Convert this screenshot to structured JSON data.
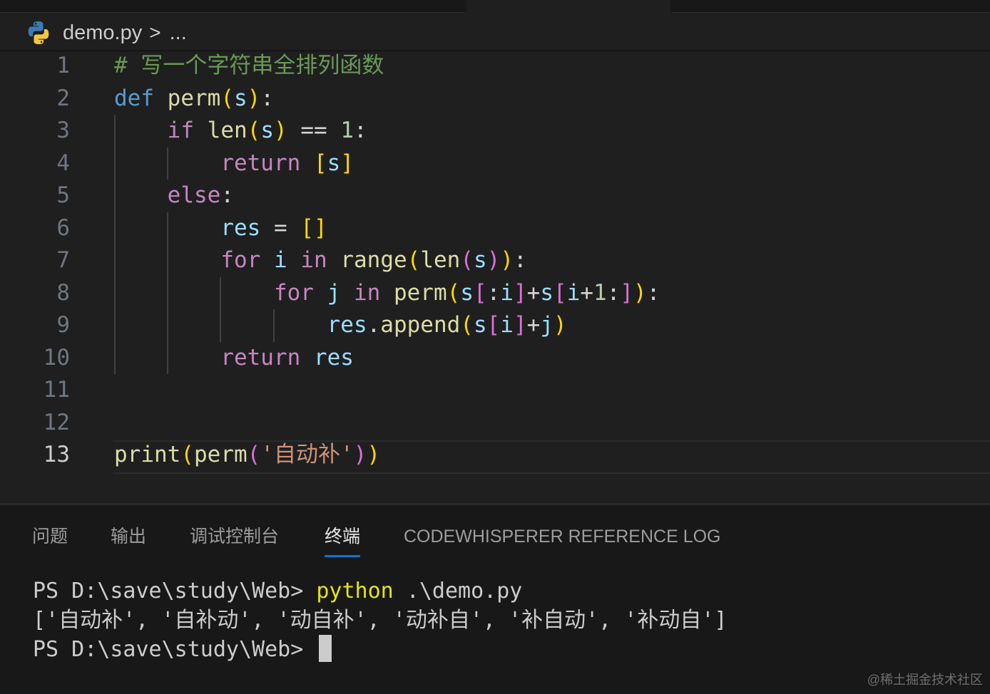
{
  "breadcrumb": {
    "file": "demo.py",
    "separator": ">",
    "ellipsis": "..."
  },
  "editor": {
    "lines": [
      {
        "num": "1",
        "t": [
          {
            "c": "cm",
            "v": "# 写一个字符串全排列函数"
          }
        ]
      },
      {
        "num": "2",
        "t": [
          {
            "c": "df",
            "v": "def"
          },
          {
            "c": "op",
            "v": " "
          },
          {
            "c": "fn",
            "v": "perm"
          },
          {
            "c": "b1",
            "v": "("
          },
          {
            "c": "vr",
            "v": "s"
          },
          {
            "c": "b1",
            "v": ")"
          },
          {
            "c": "op",
            "v": ":"
          }
        ]
      },
      {
        "num": "3",
        "t": [
          {
            "c": "op",
            "v": "    "
          },
          {
            "c": "kw",
            "v": "if"
          },
          {
            "c": "op",
            "v": " "
          },
          {
            "c": "fn",
            "v": "len"
          },
          {
            "c": "b1",
            "v": "("
          },
          {
            "c": "vr",
            "v": "s"
          },
          {
            "c": "b1",
            "v": ")"
          },
          {
            "c": "op",
            "v": " == "
          },
          {
            "c": "nm",
            "v": "1"
          },
          {
            "c": "op",
            "v": ":"
          }
        ]
      },
      {
        "num": "4",
        "t": [
          {
            "c": "op",
            "v": "        "
          },
          {
            "c": "kw",
            "v": "return"
          },
          {
            "c": "op",
            "v": " "
          },
          {
            "c": "b1",
            "v": "["
          },
          {
            "c": "vr",
            "v": "s"
          },
          {
            "c": "b1",
            "v": "]"
          }
        ]
      },
      {
        "num": "5",
        "t": [
          {
            "c": "op",
            "v": "    "
          },
          {
            "c": "kw",
            "v": "else"
          },
          {
            "c": "op",
            "v": ":"
          }
        ]
      },
      {
        "num": "6",
        "t": [
          {
            "c": "op",
            "v": "        "
          },
          {
            "c": "vr",
            "v": "res"
          },
          {
            "c": "op",
            "v": " = "
          },
          {
            "c": "b1",
            "v": "[]"
          }
        ]
      },
      {
        "num": "7",
        "t": [
          {
            "c": "op",
            "v": "        "
          },
          {
            "c": "kw",
            "v": "for"
          },
          {
            "c": "op",
            "v": " "
          },
          {
            "c": "vr",
            "v": "i"
          },
          {
            "c": "op",
            "v": " "
          },
          {
            "c": "kw",
            "v": "in"
          },
          {
            "c": "op",
            "v": " "
          },
          {
            "c": "fn",
            "v": "range"
          },
          {
            "c": "b1",
            "v": "("
          },
          {
            "c": "fn",
            "v": "len"
          },
          {
            "c": "b2",
            "v": "("
          },
          {
            "c": "vr",
            "v": "s"
          },
          {
            "c": "b2",
            "v": ")"
          },
          {
            "c": "b1",
            "v": ")"
          },
          {
            "c": "op",
            "v": ":"
          }
        ]
      },
      {
        "num": "8",
        "t": [
          {
            "c": "op",
            "v": "            "
          },
          {
            "c": "kw",
            "v": "for"
          },
          {
            "c": "op",
            "v": " "
          },
          {
            "c": "vr",
            "v": "j"
          },
          {
            "c": "op",
            "v": " "
          },
          {
            "c": "kw",
            "v": "in"
          },
          {
            "c": "op",
            "v": " "
          },
          {
            "c": "fn",
            "v": "perm"
          },
          {
            "c": "b1",
            "v": "("
          },
          {
            "c": "vr",
            "v": "s"
          },
          {
            "c": "b2",
            "v": "["
          },
          {
            "c": "op",
            "v": ":"
          },
          {
            "c": "vr",
            "v": "i"
          },
          {
            "c": "b2",
            "v": "]"
          },
          {
            "c": "op",
            "v": "+"
          },
          {
            "c": "vr",
            "v": "s"
          },
          {
            "c": "b2",
            "v": "["
          },
          {
            "c": "vr",
            "v": "i"
          },
          {
            "c": "op",
            "v": "+"
          },
          {
            "c": "nm",
            "v": "1"
          },
          {
            "c": "op",
            "v": ":"
          },
          {
            "c": "b2",
            "v": "]"
          },
          {
            "c": "b1",
            "v": ")"
          },
          {
            "c": "op",
            "v": ":"
          }
        ]
      },
      {
        "num": "9",
        "t": [
          {
            "c": "op",
            "v": "                "
          },
          {
            "c": "vr",
            "v": "res"
          },
          {
            "c": "op",
            "v": "."
          },
          {
            "c": "fn",
            "v": "append"
          },
          {
            "c": "b1",
            "v": "("
          },
          {
            "c": "vr",
            "v": "s"
          },
          {
            "c": "b2",
            "v": "["
          },
          {
            "c": "vr",
            "v": "i"
          },
          {
            "c": "b2",
            "v": "]"
          },
          {
            "c": "op",
            "v": "+"
          },
          {
            "c": "vr",
            "v": "j"
          },
          {
            "c": "b1",
            "v": ")"
          }
        ]
      },
      {
        "num": "10",
        "t": [
          {
            "c": "op",
            "v": "        "
          },
          {
            "c": "kw",
            "v": "return"
          },
          {
            "c": "op",
            "v": " "
          },
          {
            "c": "vr",
            "v": "res"
          }
        ]
      },
      {
        "num": "11",
        "t": []
      },
      {
        "num": "12",
        "t": []
      },
      {
        "num": "13",
        "t": [
          {
            "c": "fn",
            "v": "print"
          },
          {
            "c": "b1",
            "v": "("
          },
          {
            "c": "fn",
            "v": "perm"
          },
          {
            "c": "b2",
            "v": "("
          },
          {
            "c": "st",
            "v": "'自动补'"
          },
          {
            "c": "b2",
            "v": ")"
          },
          {
            "c": "b1",
            "v": ")"
          }
        ],
        "active": true
      }
    ]
  },
  "panel": {
    "tabs": [
      {
        "label": "问题",
        "active": false
      },
      {
        "label": "输出",
        "active": false
      },
      {
        "label": "调试控制台",
        "active": false
      },
      {
        "label": "终端",
        "active": true
      },
      {
        "label": "CODEWHISPERER REFERENCE LOG",
        "active": false
      }
    ]
  },
  "terminal": {
    "prompt": "PS D:\\save\\study\\Web> ",
    "command": "python",
    "args": " .\\demo.py",
    "output": "['自动补', '自补动', '动自补', '动补自', '补自动', '补动自']",
    "prompt2": "PS D:\\save\\study\\Web> "
  },
  "watermark": "@稀土掘金技术社区",
  "colors": {
    "background": "#1f1f1f",
    "panel": "#181818",
    "accent": "#0078d4",
    "comment": "#6a9955",
    "keyword": "#c586c0",
    "function": "#dcdcaa",
    "variable": "#9cdcfe",
    "bracket1": "#ffd700",
    "bracket2": "#da70d6"
  },
  "icons": {
    "file": "python-icon"
  }
}
